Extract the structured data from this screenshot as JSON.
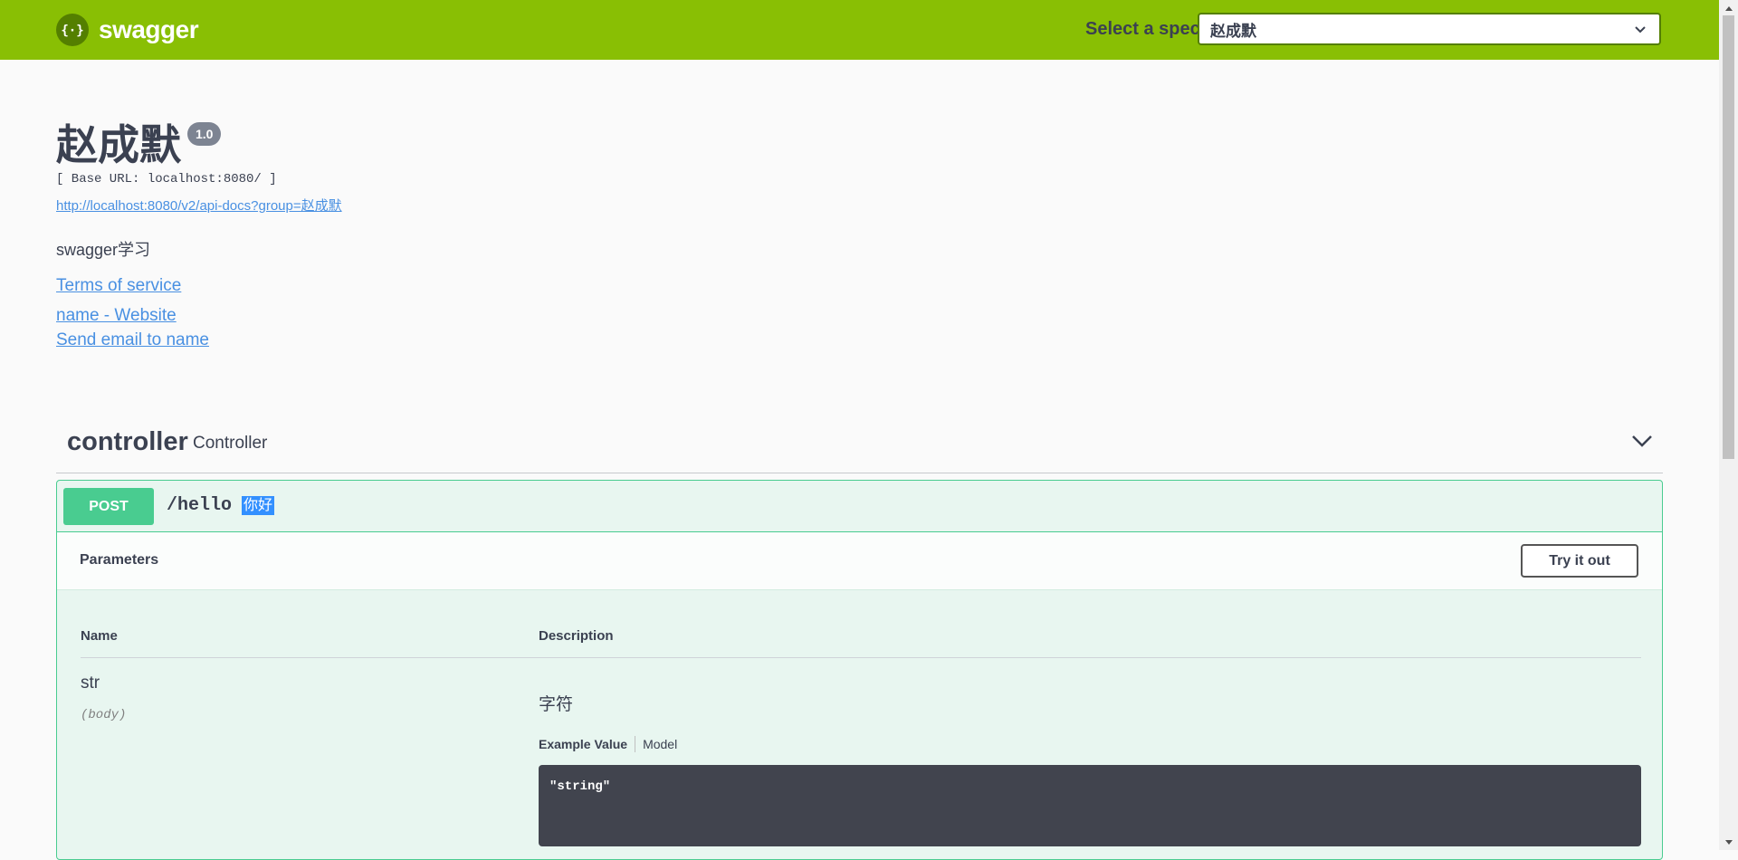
{
  "topbar": {
    "logo_text": "swagger",
    "spec_label": "Select a spec",
    "spec_selected": "赵成默"
  },
  "info": {
    "title": "赵成默",
    "version": "1.0",
    "base_url": "[ Base URL: localhost:8080/ ]",
    "api_docs_link": "http://localhost:8080/v2/api-docs?group=赵成默",
    "description": "swagger学习",
    "terms_link": "Terms of service",
    "contact_website": "name - Website",
    "contact_email": "Send email to name"
  },
  "tag": {
    "name": "controller",
    "description": "Controller"
  },
  "operation": {
    "method": "POST",
    "path": "/hello",
    "summary": "你好",
    "parameters_title": "Parameters",
    "try_button": "Try it out",
    "columns": {
      "name": "Name",
      "description": "Description"
    },
    "param": {
      "name": "str",
      "in": "(body)",
      "description": "字符",
      "tab_example": "Example Value",
      "tab_model": "Model",
      "example": "\"string\""
    }
  },
  "colors": {
    "topbar": "#89bf04",
    "post": "#49cc90",
    "link": "#4990e2",
    "text": "#3b4151"
  }
}
